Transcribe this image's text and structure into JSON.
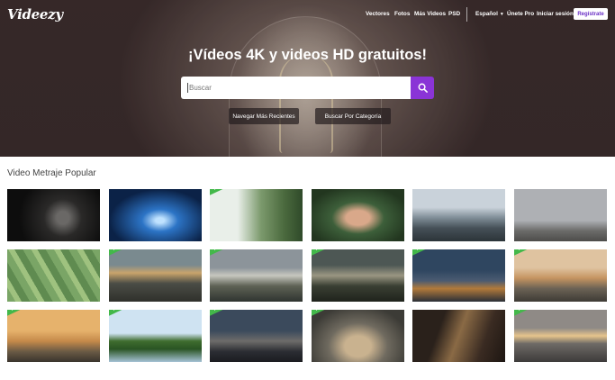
{
  "brand": {
    "logo": "Videezy"
  },
  "nav": {
    "items": [
      "Vectores",
      "Fotos",
      "Más Videos",
      "PSD"
    ],
    "language": "Español",
    "pro": "Únete Pro",
    "login": "Iniciar sesión",
    "register": "Regístrate"
  },
  "hero": {
    "title": "¡Vídeos 4K y videos HD gratuitos!",
    "search_placeholder": "Buscar",
    "browse_recent": "Navegar Más Recientes",
    "browse_category": "Buscar Por Categoría"
  },
  "section": {
    "title": "Video Metraje Popular"
  },
  "colors": {
    "accent": "#8a34d6",
    "pro_badge": "#43b84a"
  },
  "videos": [
    {
      "scene": "dark-camera-lens",
      "pro": false
    },
    {
      "scene": "hands-phone-blue",
      "pro": false
    },
    {
      "scene": "man-smiling-outdoors",
      "pro": true
    },
    {
      "scene": "girl-headphones",
      "pro": false
    },
    {
      "scene": "harbor-cloudy-sky",
      "pro": false
    },
    {
      "scene": "man-antenna-sky",
      "pro": false
    },
    {
      "scene": "aerial-green-fields",
      "pro": false
    },
    {
      "scene": "city-sunset-aerial",
      "pro": true
    },
    {
      "scene": "waterfront-sunset",
      "pro": true
    },
    {
      "scene": "storm-clouds-horizon",
      "pro": true
    },
    {
      "scene": "ship-dusk-harbor",
      "pro": true
    },
    {
      "scene": "coast-sunset-sea",
      "pro": true
    },
    {
      "scene": "pier-silhouette-sunset",
      "pro": true
    },
    {
      "scene": "tree-island-lake",
      "pro": true
    },
    {
      "scene": "city-night-skyline",
      "pro": true
    },
    {
      "scene": "roundabout-aerial",
      "pro": true
    },
    {
      "scene": "guitar-closeup",
      "pro": false
    },
    {
      "scene": "sunset-clouds-horizon",
      "pro": true
    }
  ]
}
